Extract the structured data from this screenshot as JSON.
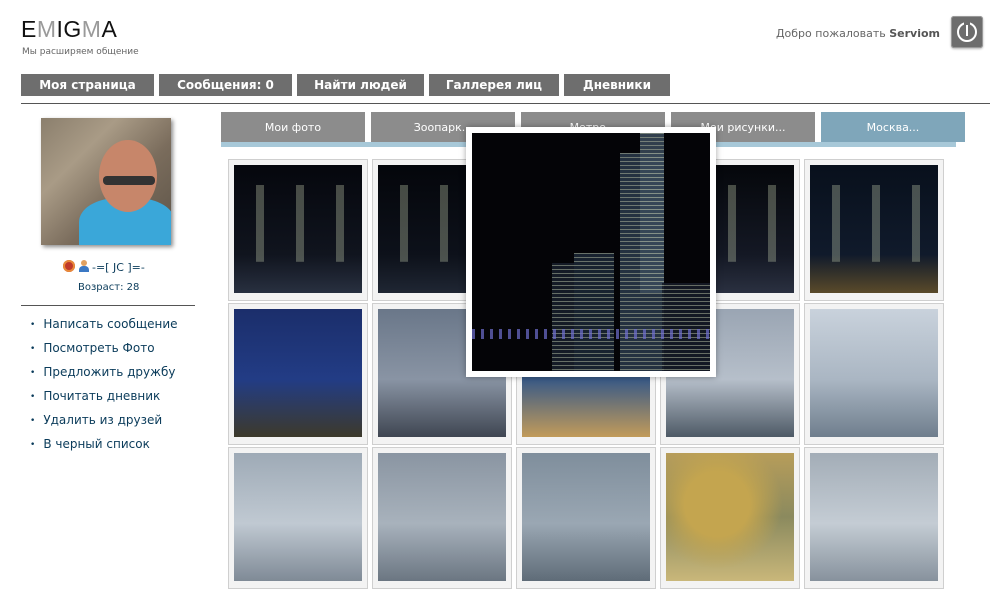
{
  "header": {
    "logo": {
      "e": "E",
      "m": "M",
      "ig": "IG",
      "m2": "M",
      "a": "A"
    },
    "tagline": "Мы расширяем общение",
    "welcome_prefix": "Добро пожаловать",
    "username": "Serviom"
  },
  "topnav": [
    {
      "label": "Моя страница"
    },
    {
      "label": "Сообщения: 0"
    },
    {
      "label": "Найти людей"
    },
    {
      "label": "Галлерея лиц"
    },
    {
      "label": "Дневники"
    }
  ],
  "profile": {
    "nickname": "-=[ JC ]=-",
    "age_label": "Возраст: 28"
  },
  "sidemenu": [
    {
      "label": "Написать сообщение"
    },
    {
      "label": "Посмотреть Фото"
    },
    {
      "label": "Предложить дружбу"
    },
    {
      "label": "Почитать дневник"
    },
    {
      "label": "Удалить из друзей"
    },
    {
      "label": "В черный список"
    }
  ],
  "albums": [
    {
      "label": "Мои фото"
    },
    {
      "label": "Зоопарк..."
    },
    {
      "label": "Метро..."
    },
    {
      "label": "Мои рисунки..."
    },
    {
      "label": "Москва..."
    }
  ],
  "active_album_index": 4,
  "gallery": {
    "photos": [
      {
        "scene": "night-towers",
        "colors": [
          "#05070d",
          "#10141e",
          "#283040"
        ]
      },
      {
        "scene": "night-towers",
        "colors": [
          "#04060b",
          "#0d111a",
          "#1f2633"
        ]
      },
      {
        "scene": "hidden",
        "colors": [
          "#0a0c12",
          "#1a1d26",
          "#2a2e38"
        ]
      },
      {
        "scene": "night-city",
        "colors": [
          "#05070b",
          "#141824",
          "#2a3040"
        ]
      },
      {
        "scene": "lit-palace",
        "colors": [
          "#08101c",
          "#101a2b",
          "#5a4a2a"
        ]
      },
      {
        "scene": "hotel-dusk",
        "colors": [
          "#1b2e6b",
          "#223c85",
          "#3d3a2b"
        ]
      },
      {
        "scene": "river-cloudy",
        "colors": [
          "#6a7789",
          "#8994a4",
          "#3f4652"
        ]
      },
      {
        "scene": "hotel-evening",
        "colors": [
          "#25436e",
          "#3a5a86",
          "#c29b5a"
        ]
      },
      {
        "scene": "river-city",
        "colors": [
          "#9aa5b3",
          "#b6bfca",
          "#4e5a66"
        ]
      },
      {
        "scene": "city-towers",
        "colors": [
          "#c9d2dc",
          "#aab6c3",
          "#6f7e8d"
        ]
      },
      {
        "scene": "sky",
        "colors": [
          "#9eaab6",
          "#c0c9d2",
          "#7f8a96"
        ]
      },
      {
        "scene": "sky",
        "colors": [
          "#8a95a2",
          "#a8b2bc",
          "#6b7682"
        ]
      },
      {
        "scene": "sky",
        "colors": [
          "#7f8e9c",
          "#9aa7b3",
          "#5f6c78"
        ]
      },
      {
        "scene": "autumn-tree",
        "colors": [
          "#b79d5a",
          "#8b8a5e",
          "#c9b77a"
        ]
      },
      {
        "scene": "sky",
        "colors": [
          "#a3adb7",
          "#c4ccd4",
          "#87929d"
        ]
      }
    ]
  },
  "overlay": {
    "scene": "night-skyline",
    "colors": [
      "#040407",
      "#141826",
      "#3a3a7a"
    ]
  }
}
